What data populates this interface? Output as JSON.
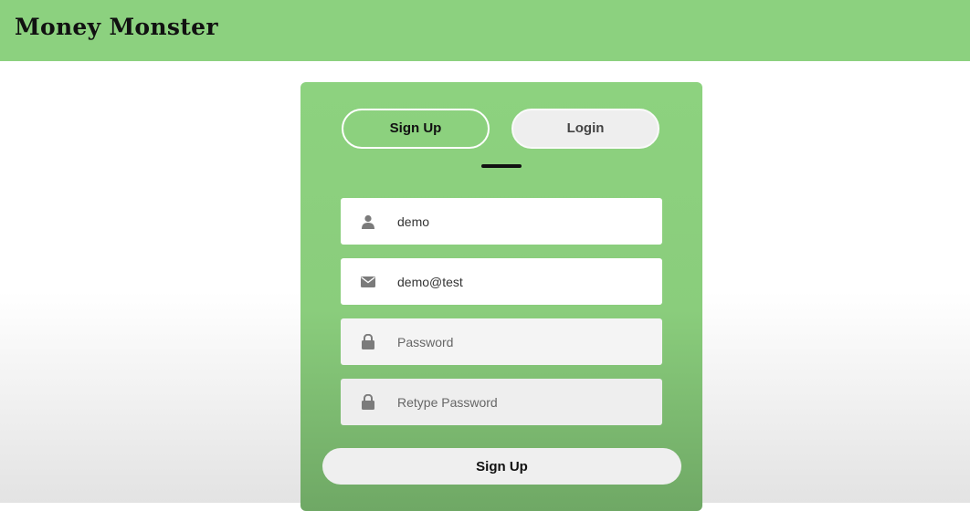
{
  "header": {
    "title": "Money Monster",
    "background_color": "#8cd17f"
  },
  "auth_card": {
    "background_color": "#8acd7c",
    "tabs": [
      {
        "label": "Sign Up",
        "active": true
      },
      {
        "label": "Login",
        "active": false
      }
    ],
    "fields": [
      {
        "icon": "user-icon",
        "value": "demo",
        "placeholder": ""
      },
      {
        "icon": "envelope-icon",
        "value": "demo@test",
        "placeholder": ""
      },
      {
        "icon": "lock-icon",
        "value": "",
        "placeholder": "Password"
      },
      {
        "icon": "lock-icon",
        "value": "",
        "placeholder": "Retype Password"
      }
    ],
    "submit_label": "Sign Up"
  }
}
